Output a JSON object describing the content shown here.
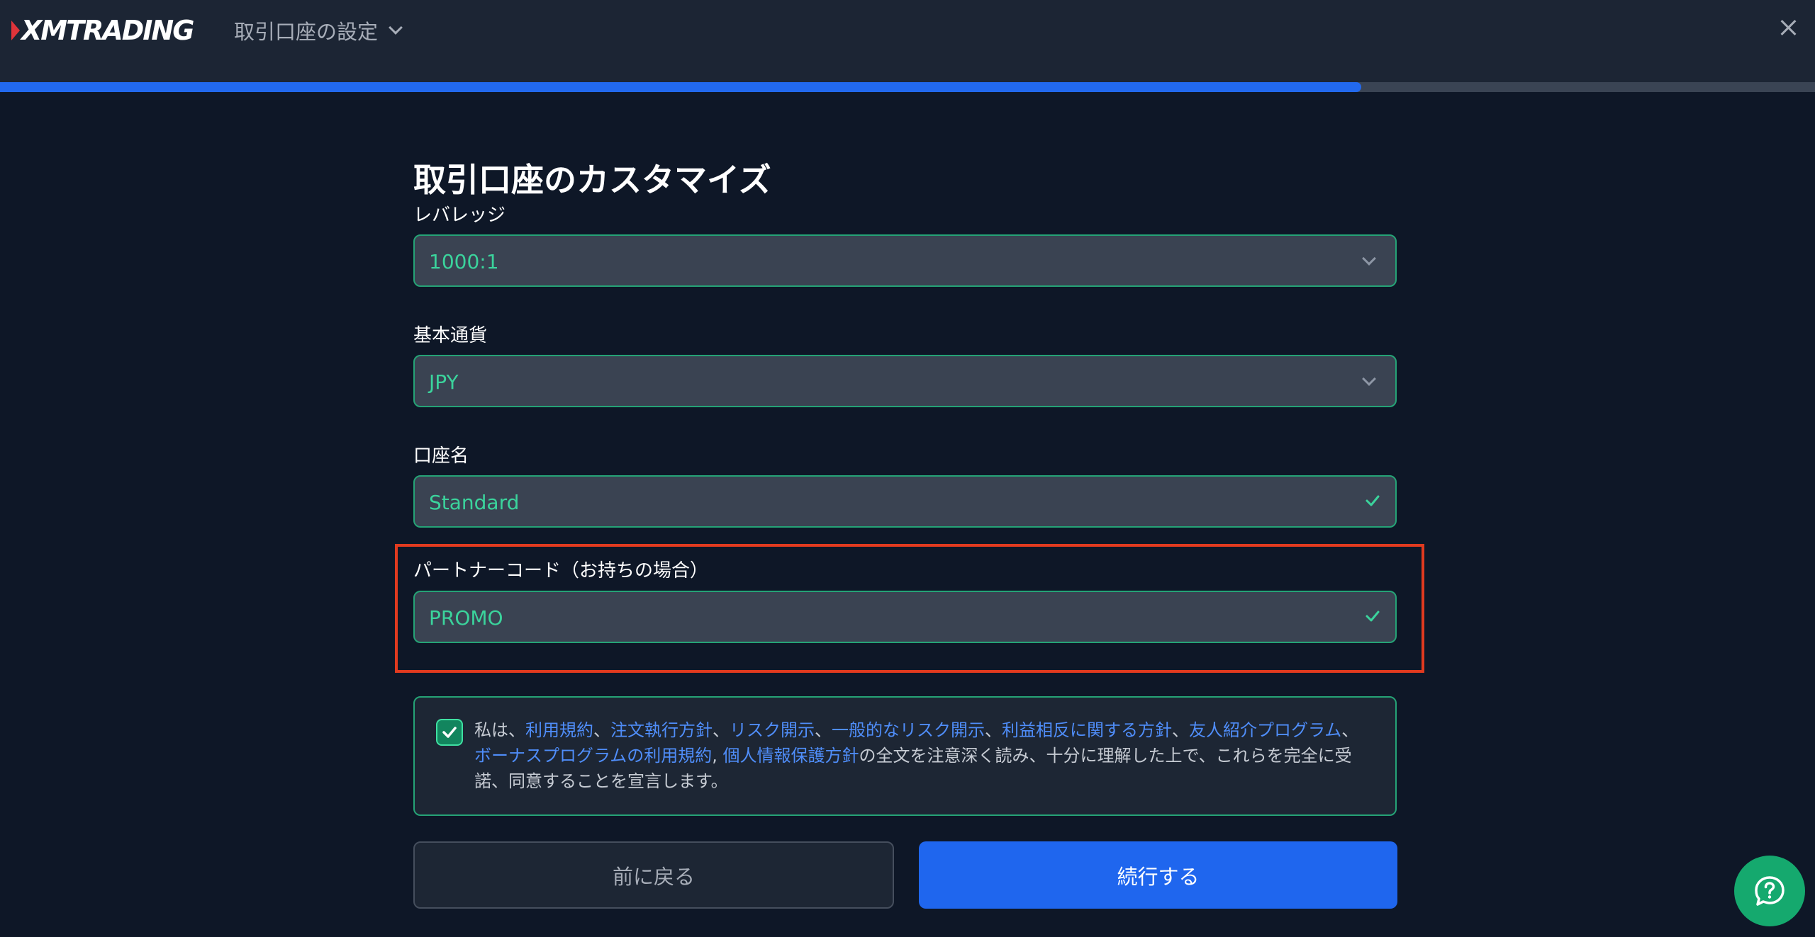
{
  "header": {
    "logo_text": "XMTRADING",
    "step_title": "取引口座の設定",
    "close_icon": "close-icon",
    "progress": 0.75
  },
  "form": {
    "title": "取引口座のカスタマイズ",
    "leverage": {
      "label": "レバレッジ",
      "value": "1000:1"
    },
    "currency": {
      "label": "基本通貨",
      "value": "JPY"
    },
    "account_name": {
      "label": "口座名",
      "value": "Standard"
    },
    "partner_code": {
      "label": "パートナーコード（お持ちの場合）",
      "value": "PROMO"
    }
  },
  "consent": {
    "checked": true,
    "prefix": "私は、",
    "links": [
      "利用規約",
      "注文執行方針",
      "リスク開示",
      "一般的なリスク開示",
      "利益相反に関する方針",
      "友人紹介プログラム",
      "ボーナスプログラムの利用規約",
      "個人情報保護方針"
    ],
    "separators": [
      "、",
      "、",
      "、",
      "、",
      "、",
      "、",
      ", "
    ],
    "suffix": "の全文を注意深く読み、十分に理解した上で、これらを完全に受諾、同意することを宣言します。"
  },
  "buttons": {
    "back": "前に戻る",
    "continue": "続行する"
  },
  "help_icon": "help-question-icon",
  "colors": {
    "accent": "#1f66ee",
    "valid": "#3bd39c",
    "highlight": "#e13a1f",
    "help": "#15a96e"
  }
}
